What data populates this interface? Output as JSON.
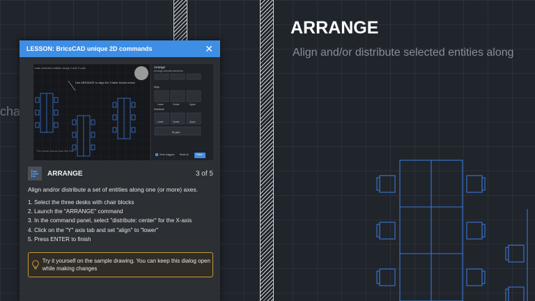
{
  "canvas": {
    "heading": "ARRANGE",
    "subheading": "Align and/or distribute selected entities along",
    "partial_text": "cha"
  },
  "dialog": {
    "title": "LESSON: BricsCAD unique 2D commands",
    "close_label": "✕",
    "step_title": "ARRANGE",
    "step_counter": "3 of 5",
    "description": "Align and/or distribute a set of entities along one (or more) axes.",
    "steps": [
      "1. Select the three desks with chair blocks",
      "2. Launch the \"ARRANGE\" command",
      "3. In the command panel, select \"distribute: center\" for the X-axis",
      "4. Click on the \"Y\" axis tab and set \"align\" to \"lower\"",
      "5. Press ENTER to finish"
    ],
    "tip": "Try it yourself on the sample drawing. You can keep this dialog open while making changes"
  },
  "thumbnail": {
    "caption_top": "icate selected entities along X and Z axis.",
    "callout": "Use ARRANGE to align the 3 table blocks below",
    "panel_title": "Arrange",
    "panel_sub": "Arrange selected elements",
    "align_label": "Align",
    "align_options": [
      "Lower",
      "Center",
      "Upper"
    ],
    "distribute_label": "Distribute",
    "distribute_options": [
      "Lower",
      "Center",
      "Upper"
    ],
    "by_gaps_label": "By gaps",
    "show_draggers": "Show draggers",
    "reset_all": "Reset all",
    "finish": "Finish",
    "bottom_note": "The result should look like this"
  },
  "colors": {
    "accent": "#3e8ee6",
    "background": "#20242b",
    "drawing_lines": "#3a78d6",
    "tip_border": "#c79a3a"
  }
}
